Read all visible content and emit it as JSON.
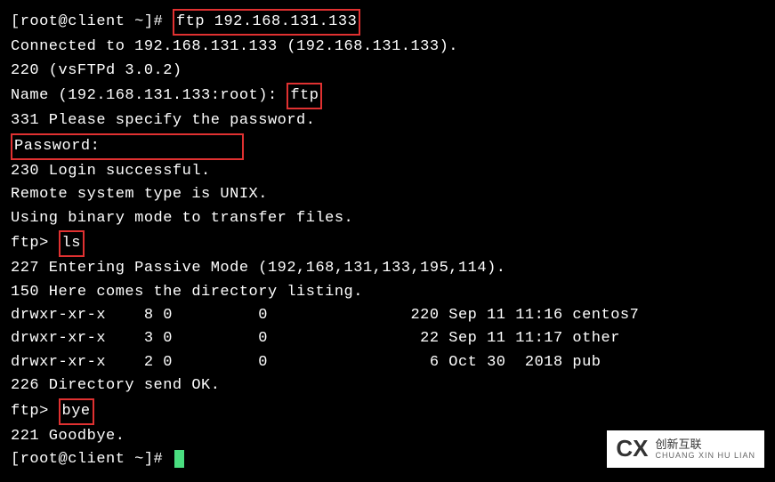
{
  "prompt1_prefix": "[root@client ~]# ",
  "prompt1_cmd": "ftp 192.168.131.133",
  "line_connected": "Connected to 192.168.131.133 (192.168.131.133).",
  "line_220": "220 (vsFTPd 3.0.2)",
  "name_prefix": "Name (192.168.131.133:root): ",
  "name_input": "ftp",
  "line_331": "331 Please specify the password.",
  "password_label": "Password:",
  "line_230": "230 Login successful.",
  "line_remote": "Remote system type is UNIX.",
  "line_binary": "Using binary mode to transfer files.",
  "ftp_prompt1_prefix": "ftp> ",
  "ftp_cmd_ls": "ls",
  "line_227": "227 Entering Passive Mode (192,168,131,133,195,114).",
  "line_150": "150 Here comes the directory listing.",
  "listing": [
    {
      "perm": "drwxr-xr-x",
      "links": "8",
      "owner": "0",
      "group": "0",
      "size": "220",
      "date": "Sep 11 11:16",
      "name": "centos7"
    },
    {
      "perm": "drwxr-xr-x",
      "links": "3",
      "owner": "0",
      "group": "0",
      "size": "22",
      "date": "Sep 11 11:17",
      "name": "other"
    },
    {
      "perm": "drwxr-xr-x",
      "links": "2",
      "owner": "0",
      "group": "0",
      "size": "6",
      "date": "Oct 30  2018",
      "name": "pub"
    }
  ],
  "line_226": "226 Directory send OK.",
  "ftp_prompt2_prefix": "ftp> ",
  "ftp_cmd_bye": "bye",
  "line_221": "221 Goodbye.",
  "prompt2_prefix": "[root@client ~]# ",
  "watermark_main": "创新互联",
  "watermark_sub": "CHUANG XIN HU LIAN"
}
